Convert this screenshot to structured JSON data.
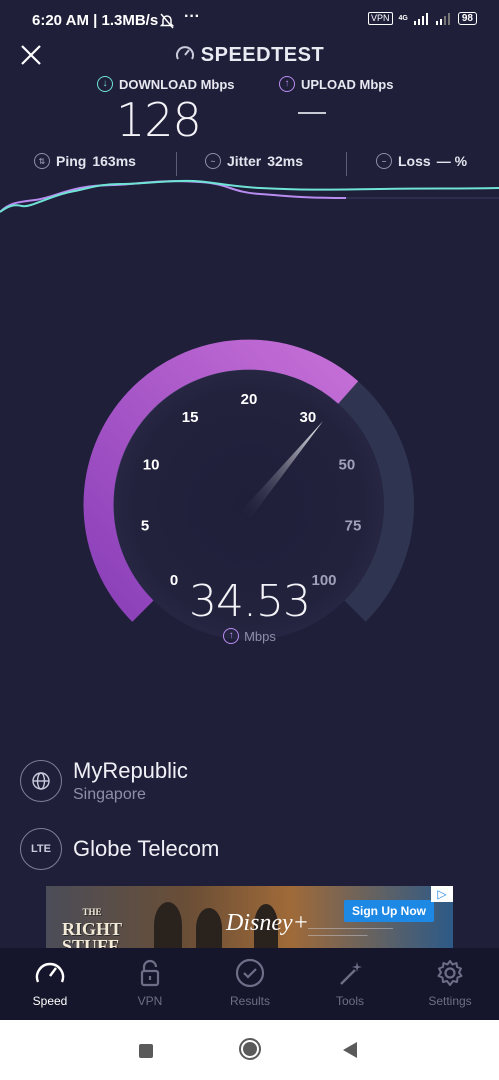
{
  "status_bar": {
    "time": "6:20 AM | 1.3MB/s",
    "vpn": "VPN",
    "network": "4G",
    "battery": "98"
  },
  "header": {
    "title": "SPEEDTEST"
  },
  "results": {
    "download_label": "DOWNLOAD Mbps",
    "upload_label": "UPLOAD Mbps",
    "download_value": "128",
    "upload_value": "—"
  },
  "stats": {
    "ping_label": "Ping",
    "ping_value": "163ms",
    "jitter_label": "Jitter",
    "jitter_value": "32ms",
    "loss_label": "Loss",
    "loss_value": "— %"
  },
  "gauge": {
    "value": "34.53",
    "unit": "Mbps",
    "ticks": [
      "0",
      "5",
      "10",
      "15",
      "20",
      "30",
      "50",
      "75",
      "100"
    ],
    "current_mbps": 34.53,
    "arc_color": "#b55fd2",
    "track_color": "#2f3550"
  },
  "server": {
    "isp_name": "MyRepublic",
    "isp_location": "Singapore",
    "carrier_badge": "LTE",
    "carrier_name": "Globe Telecom"
  },
  "ad": {
    "title_line1": "THE",
    "title_line2": "RIGHT",
    "title_line3": "STUFF",
    "brand": "Disney+",
    "cta": "Sign Up Now"
  },
  "nav": {
    "speed": "Speed",
    "vpn": "VPN",
    "results": "Results",
    "tools": "Tools",
    "settings": "Settings"
  },
  "colors": {
    "background": "#1f1f3a",
    "download_accent": "#6fe3d5",
    "upload_accent": "#b98cf0"
  }
}
